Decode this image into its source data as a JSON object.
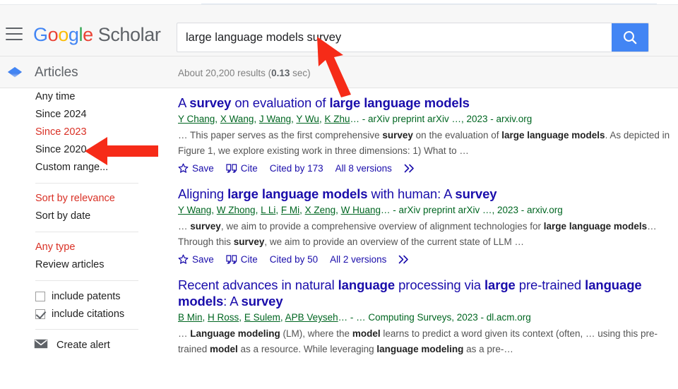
{
  "header": {
    "menu_icon": "hamburger-menu-icon",
    "brand": {
      "g": "G",
      "o1": "o",
      "o2": "o",
      "g2": "g",
      "l": "l",
      "e": "e",
      "scholar": "Scholar"
    },
    "search": {
      "value": "large language models survey",
      "placeholder": "",
      "button_icon": "search-icon"
    }
  },
  "articles_bar": {
    "icon": "articles-diamond-icon",
    "label": "Articles",
    "results_prefix": "About 20,200 results (",
    "results_time": "0.13",
    "results_suffix": " sec)"
  },
  "sidebar": {
    "time_filters": [
      {
        "label": "Any time",
        "active": false
      },
      {
        "label": "Since 2024",
        "active": false
      },
      {
        "label": "Since 2023",
        "active": true
      },
      {
        "label": "Since 2020",
        "active": false
      },
      {
        "label": "Custom range...",
        "active": false
      }
    ],
    "sort_filters": [
      {
        "label": "Sort by relevance",
        "active": true
      },
      {
        "label": "Sort by date",
        "active": false
      }
    ],
    "type_filters": [
      {
        "label": "Any type",
        "active": true
      },
      {
        "label": "Review articles",
        "active": false
      }
    ],
    "checkboxes": [
      {
        "label": "include patents",
        "checked": false
      },
      {
        "label": "include citations",
        "checked": true
      }
    ],
    "create_alert": {
      "icon": "envelope-icon",
      "label": "Create alert"
    }
  },
  "results": [
    {
      "title_parts": [
        {
          "t": "A ",
          "b": false
        },
        {
          "t": "survey",
          "b": true
        },
        {
          "t": " on evaluation of ",
          "b": false
        },
        {
          "t": "large language models",
          "b": true
        }
      ],
      "authors": [
        "Y Chang",
        "X Wang",
        "J Wang",
        "Y Wu",
        "K Zhu"
      ],
      "meta_tail": "… - arXiv preprint arXiv …, 2023 - arxiv.org",
      "snippet_parts": [
        {
          "t": "… This paper serves as the first comprehensive ",
          "b": false
        },
        {
          "t": "survey",
          "b": true
        },
        {
          "t": " on the evaluation of ",
          "b": false
        },
        {
          "t": "large language models",
          "b": true
        },
        {
          "t": ". As depicted in Figure 1, we explore existing work in three dimensions: 1) What to …",
          "b": false
        }
      ],
      "actions": {
        "save": "Save",
        "cite": "Cite",
        "cited_by": "Cited by 173",
        "versions": "All 8 versions",
        "more_icon": "double-chevron-icon"
      }
    },
    {
      "title_parts": [
        {
          "t": "Aligning ",
          "b": false
        },
        {
          "t": "large language models",
          "b": true
        },
        {
          "t": " with human: A ",
          "b": false
        },
        {
          "t": "survey",
          "b": true
        }
      ],
      "authors": [
        "Y Wang",
        "W Zhong",
        "L Li",
        "F Mi",
        "X Zeng",
        "W Huang"
      ],
      "meta_tail": "… - arXiv preprint arXiv …, 2023 - arxiv.org",
      "snippet_parts": [
        {
          "t": "… ",
          "b": false
        },
        {
          "t": "survey",
          "b": true
        },
        {
          "t": ", we aim to provide a comprehensive overview of alignment technologies for ",
          "b": false
        },
        {
          "t": "large language models",
          "b": true
        },
        {
          "t": "… Through this ",
          "b": false
        },
        {
          "t": "survey",
          "b": true
        },
        {
          "t": ", we aim to provide an overview of the current state of LLM …",
          "b": false
        }
      ],
      "actions": {
        "save": "Save",
        "cite": "Cite",
        "cited_by": "Cited by 50",
        "versions": "All 2 versions",
        "more_icon": "double-chevron-icon"
      }
    },
    {
      "title_parts": [
        {
          "t": "Recent advances in natural ",
          "b": false
        },
        {
          "t": "language",
          "b": true
        },
        {
          "t": " processing via ",
          "b": false
        },
        {
          "t": "large",
          "b": true
        },
        {
          "t": " pre-trained ",
          "b": false
        },
        {
          "t": "language models",
          "b": true
        },
        {
          "t": ": A ",
          "b": false
        },
        {
          "t": "survey",
          "b": true
        }
      ],
      "authors": [
        "B Min",
        "H Ross",
        "E Sulem",
        "APB Veyseh"
      ],
      "meta_tail": "… - … Computing Surveys, 2023 - dl.acm.org",
      "snippet_parts": [
        {
          "t": "… ",
          "b": false
        },
        {
          "t": "Language modeling",
          "b": true
        },
        {
          "t": " (LM), where the ",
          "b": false
        },
        {
          "t": "model",
          "b": true
        },
        {
          "t": " learns to predict a word given its context (often, … using this pre-trained ",
          "b": false
        },
        {
          "t": "model",
          "b": true
        },
        {
          "t": " as a resource. While leveraging ",
          "b": false
        },
        {
          "t": "language modeling",
          "b": true
        },
        {
          "t": " as a pre-…",
          "b": false
        }
      ],
      "actions": null
    }
  ],
  "annotations": [
    {
      "name": "arrow-pointing-at-search-query",
      "color": "#f62b18"
    },
    {
      "name": "arrow-pointing-at-since-2023",
      "color": "#f62b18"
    }
  ],
  "colors": {
    "link_blue": "#1a0dab",
    "green": "#006621",
    "red_active": "#d93025",
    "accent_blue": "#4285F4",
    "annotation_red": "#f62b18"
  }
}
